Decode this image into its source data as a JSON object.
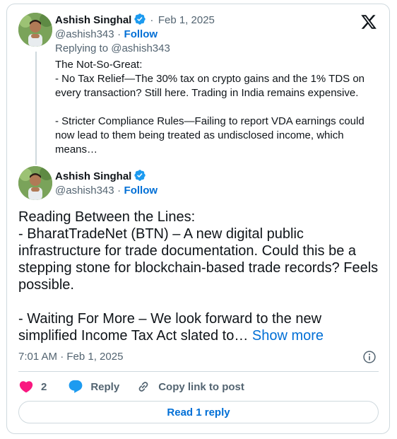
{
  "reply_tweet": {
    "author_name": "Ashish Singhal",
    "handle": "@ashish343",
    "date": "Feb 1, 2025",
    "date_separator": "·",
    "follow_label": "Follow",
    "follow_separator": "·",
    "replying_to": "Replying to @ashish343",
    "text": "The Not-So-Great:\n- No Tax Relief—The 30% tax on crypto gains and the 1% TDS on every transaction? Still here. Trading in India remains expensive.\n\n- Stricter Compliance Rules—Failing to report VDA earnings could now lead to them being treated as undisclosed income, which means…"
  },
  "main_tweet": {
    "author_name": "Ashish Singhal",
    "handle": "@ashish343",
    "follow_label": "Follow",
    "follow_separator": "·",
    "text": "Reading Between the Lines:\n- BharatTradeNet (BTN) – A new digital public infrastructure for trade documentation. Could this be a stepping stone for blockchain-based trade records? Feels possible.\n\n- Waiting For More – We look forward to the new simplified Income Tax Act slated to…",
    "show_more_label": "Show more",
    "timestamp": "7:01 AM · Feb 1, 2025"
  },
  "actions": {
    "like_count": "2",
    "reply_label": "Reply",
    "copy_link_label": "Copy link to post"
  },
  "read_reply_label": "Read 1 reply",
  "colors": {
    "accent": "#006fd6",
    "verified": "#1d9bf0",
    "like": "#f91880",
    "muted": "#536471",
    "border": "#cfd9de"
  },
  "icons": [
    "x-logo-icon",
    "verified-badge-icon",
    "info-icon",
    "heart-icon",
    "reply-bubble-icon",
    "link-icon"
  ]
}
